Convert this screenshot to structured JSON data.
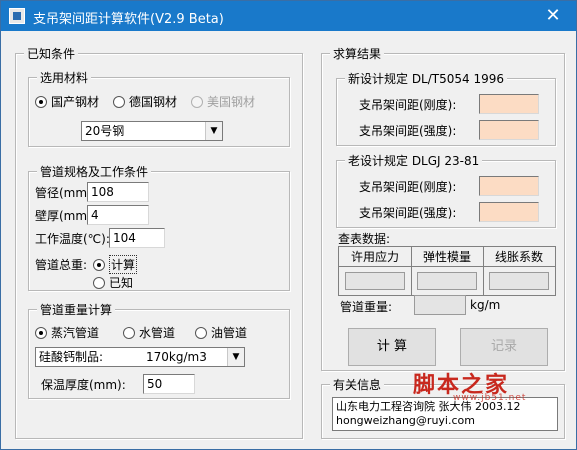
{
  "window": {
    "title": "支吊架间距计算软件(V2.9 Beta)",
    "close_glyph": "✕"
  },
  "known": {
    "label": "已知条件",
    "material": {
      "label": "选用材料",
      "options": [
        "国产钢材",
        "德国钢材",
        "美国钢材"
      ],
      "selected": "20号钢"
    },
    "spec": {
      "label": "管道规格及工作条件",
      "diameter_label": "管径(mm):",
      "diameter_value": "108",
      "thickness_label": "壁厚(mm):",
      "thickness_value": "4",
      "temperature_label": "工作温度(℃):",
      "temperature_value": "104",
      "total_weight_label": "管道总重:",
      "calc_option": "计算",
      "known_option": "已知"
    },
    "weight_calc": {
      "label": "管道重量计算",
      "options": [
        "蒸汽管道",
        "水管道",
        "油管道"
      ],
      "insulation_material": "硅酸钙制品:",
      "insulation_density": "170kg/m3",
      "insulation_thickness_label": "保温厚度(mm):",
      "insulation_thickness_value": "50"
    }
  },
  "results": {
    "label": "求算结果",
    "new_rule": {
      "label": "新设计规定  DL/T5054 1996",
      "stiffness_label": "支吊架间距(刚度):",
      "strength_label": "支吊架间距(强度):"
    },
    "old_rule": {
      "label": "老设计规定  DLGJ 23-81",
      "stiffness_label": "支吊架间距(刚度):",
      "strength_label": "支吊架间距(强度):"
    },
    "lookup": {
      "label": "查表数据:",
      "columns": [
        "许用应力",
        "弹性模量",
        "线胀系数"
      ]
    },
    "pipe_weight_label": "管道重量:",
    "pipe_weight_unit": "kg/m",
    "calc_button": "计 算",
    "record_button": "记录"
  },
  "about": {
    "label": "有关信息",
    "lines": [
      "山东电力工程咨询院   张大伟  2003.12",
      "hongweizhang@ruyi.com"
    ],
    "watermark": "脚本之家",
    "watermark_sub": "www.jb51.net"
  }
}
